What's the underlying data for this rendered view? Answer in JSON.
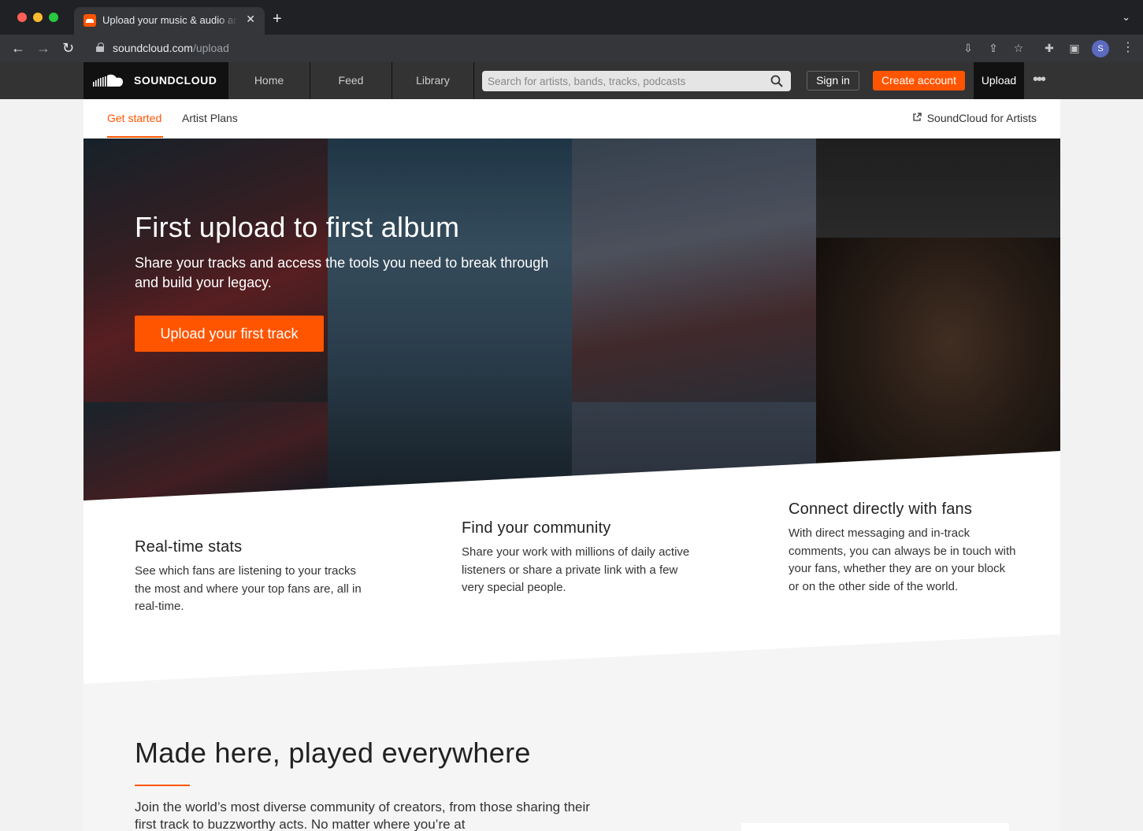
{
  "browser": {
    "tab_title": "Upload your music & audio and share it with the world",
    "tab_close": "✕",
    "new_tab": "+",
    "url_host": "soundcloud.com",
    "url_path": "/upload",
    "profile_initial": "S"
  },
  "header": {
    "logo_text": "SOUNDCLOUD",
    "nav": [
      "Home",
      "Feed",
      "Library"
    ],
    "search_placeholder": "Search for artists, bands, tracks, podcasts",
    "sign_in": "Sign in",
    "create_account": "Create account",
    "upload": "Upload",
    "more": "•••",
    "accent_color": "#ff5500"
  },
  "subnav": {
    "tabs": [
      "Get started",
      "Artist Plans"
    ],
    "active_tab": "Get started",
    "artists_link": "SoundCloud for Artists"
  },
  "hero": {
    "title": "First upload to first album",
    "subtitle": "Share your tracks and access the tools you need to break through and build your legacy.",
    "cta": "Upload your first track"
  },
  "features": [
    {
      "title": "Real-time stats",
      "text": "See which fans are listening to your tracks the most and where your top fans are, all in real-time."
    },
    {
      "title": "Find your community",
      "text": "Share your work with millions of daily active listeners or share a private link with a few very special people."
    },
    {
      "title": "Connect directly with fans",
      "text": "With direct messaging and in-track comments, you can always be in touch with your fans, whether they are on your block or on the other side of the world."
    }
  ],
  "made_here": {
    "title": "Made here, played everywhere",
    "text": "Join the world’s most diverse community of creators, from those sharing their first track to buzzworthy acts. No matter where you’re at"
  }
}
